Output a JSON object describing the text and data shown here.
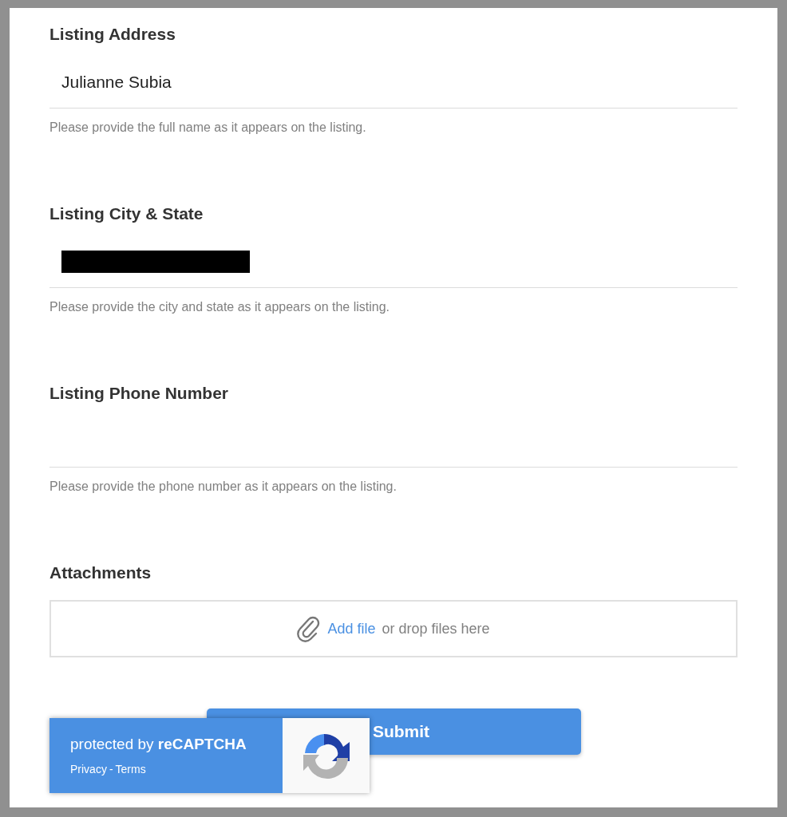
{
  "fields": [
    {
      "label": "Listing Address",
      "value": "Julianne Subia",
      "redacted": false,
      "help": "Please provide the full name as it appears on the listing."
    },
    {
      "label": "Listing City & State",
      "redacted": true,
      "help": "Please provide the city and state as it appears on the listing."
    },
    {
      "label": "Listing Phone Number",
      "redacted": false,
      "help": "Please provide the phone number as it appears on the listing."
    }
  ],
  "attachments": {
    "label": "Attachments",
    "link": "Add file",
    "text": "or drop files here"
  },
  "submit": "Submit",
  "recaptcha": {
    "prefix": "protected by",
    "brand": "reCAPTCHA",
    "privacy": "Privacy",
    "separator": "-",
    "terms": "Terms"
  }
}
